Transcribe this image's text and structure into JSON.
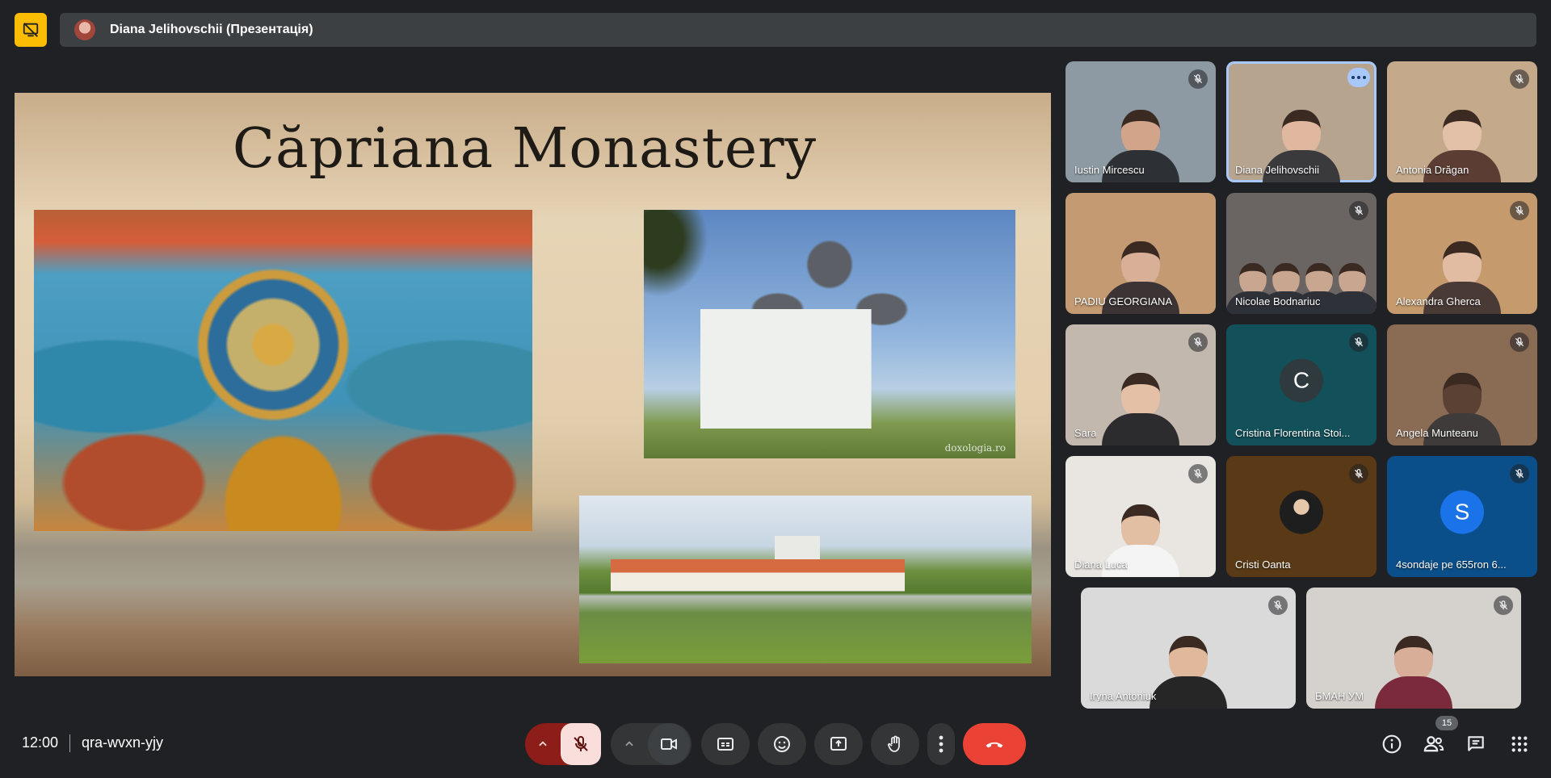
{
  "header": {
    "presenter_title": "Diana Jelihovschii (Презентація)",
    "stop_presenting_icon": "stop-presenting-icon"
  },
  "slide": {
    "title": "Căpriana Monastery",
    "watermark": "doxologia.ro"
  },
  "participants": [
    {
      "name": "Iustin Mircescu",
      "muted": true,
      "video": "person",
      "bg": "#8d9aa3",
      "skin": "#d2a58b",
      "shirt": "#2d3034"
    },
    {
      "name": "Diana Jelihovschii",
      "muted": false,
      "active": true,
      "video": "person",
      "bg": "#b7a48f",
      "skin": "#e0b8a0",
      "shirt": "#3a3a3d"
    },
    {
      "name": "Antonia Drăgan",
      "muted": true,
      "video": "person",
      "bg": "#c4a98a",
      "skin": "#e3c0a8",
      "shirt": "#5b3d33"
    },
    {
      "name": "PADIU GEORGIANA",
      "muted": false,
      "video": "person",
      "bg": "#c49a72",
      "skin": "#d8b098",
      "shirt": "#3c3434"
    },
    {
      "name": "Nicolae Bodnariuc",
      "muted": true,
      "video": "group",
      "bg": "#6a6462",
      "skin": "#c9a690",
      "shirt": "#2f3138"
    },
    {
      "name": "Alexandra Gherca",
      "muted": true,
      "video": "person",
      "bg": "#c59a6d",
      "skin": "#e1bca3",
      "shirt": "#4a3a36"
    },
    {
      "name": "Sara",
      "muted": true,
      "video": "person",
      "bg": "#c2b8ad",
      "skin": "#e4c0a6",
      "shirt": "#2c2c2f"
    },
    {
      "name": "Cristina Florentina Stoi...",
      "muted": true,
      "video": "letter",
      "letter": "C",
      "bg": "#12505a",
      "avatar_bg": "#2f3a3e"
    },
    {
      "name": "Angela Munteanu",
      "muted": true,
      "video": "person",
      "bg": "#8a6b54",
      "skin": "#5b4034",
      "shirt": "#3e3b3a"
    },
    {
      "name": "Diana Luca",
      "muted": true,
      "video": "person",
      "bg": "#e9e6e2",
      "skin": "#e2bea3",
      "shirt": "#f4f4f4"
    },
    {
      "name": "Cristi Oanta",
      "muted": true,
      "video": "photo",
      "bg": "#5a3a16",
      "skin": "#e6c7aa",
      "shirt": "#1e1e1f"
    },
    {
      "name": "4sondaje pe 655ron 6...",
      "muted": true,
      "video": "letter",
      "letter": "S",
      "bg": "#0b4f8a",
      "avatar_bg": "#1a73e8"
    },
    {
      "name": "Iryna Antoniuk",
      "muted": true,
      "video": "person",
      "bg": "#d9dad9",
      "skin": "#e0b89b",
      "shirt": "#262626"
    },
    {
      "name": "БМАН УМ",
      "muted": true,
      "video": "person",
      "bg": "#d5d1cc",
      "skin": "#d8ae98",
      "shirt": "#7a2a3a"
    }
  ],
  "footer": {
    "time": "12:00",
    "meeting_code": "qra-wvxn-yjy",
    "participant_count": "15"
  },
  "controls": {
    "mic_options": "chevron-up-icon",
    "mic": "mic-off-icon",
    "camera_options": "chevron-up-icon",
    "camera": "camera-icon",
    "captions": "captions-icon",
    "reactions": "emoji-icon",
    "present": "present-screen-icon",
    "raise_hand": "hand-icon",
    "more": "more-vert-icon",
    "leave": "leave-call-icon"
  },
  "colors": {
    "background": "#202124",
    "accent_yellow": "#fbbc04",
    "leave_red": "#ea4335",
    "active_tile": "#a8c7fa"
  }
}
